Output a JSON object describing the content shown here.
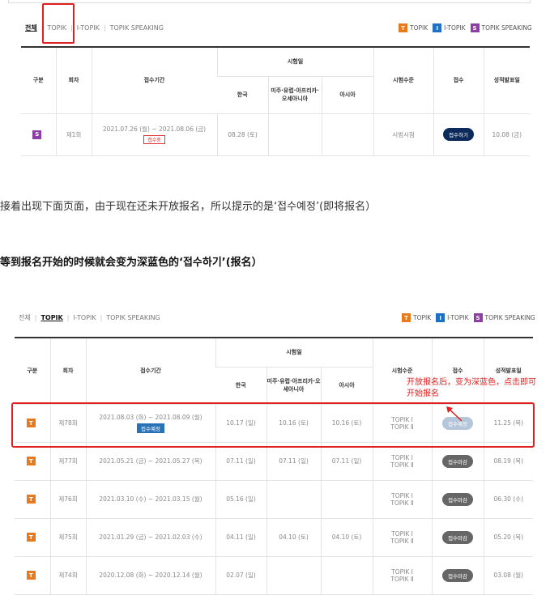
{
  "filters1": {
    "items": [
      "전체",
      "TOPIK",
      "I-TOPIK",
      "TOPIK SPEAKING"
    ],
    "active": 0
  },
  "filters2": {
    "items": [
      "전체",
      "TOPIK",
      "I-TOPIK",
      "TOPIK SPEAKING"
    ],
    "active": 1
  },
  "legend": [
    {
      "letter": "T",
      "label": "TOPIK",
      "color": "#e57a1e"
    },
    {
      "letter": "I",
      "label": "I-TOPIK",
      "color": "#1f6fc5"
    },
    {
      "letter": "S",
      "label": "TOPIK SPEAKING",
      "color": "#8e3fa6"
    }
  ],
  "headers": {
    "type": "구분",
    "round": "회차",
    "period": "접수기간",
    "exam_date": "시험일",
    "korea": "한국",
    "americas": "미주·유럽·아프리카·오세아니아",
    "asia": "아시아",
    "level": "시험수준",
    "apply": "접수",
    "result": "성적발표일"
  },
  "table1_rows": [
    {
      "type": "S",
      "round": "제1회",
      "period": "2021.07.26 (월) ~ 2021.08.06 (금)",
      "period_tag": "접수중",
      "korea": "08.28 (토)",
      "americas": "",
      "asia": "",
      "level": "시범시험",
      "apply": "접수하기",
      "result": "10.08 (금)"
    }
  ],
  "text1": "接着出现下面页面，由于现在还未开放报名，所以提示的是‘접수예정’(即将报名）",
  "text2": "等到报名开始的时候就会变为深蓝色的‘접수하기’(报名）",
  "annotation": "开放报名后，变为深蓝色，点击即可开始报名",
  "table2_rows": [
    {
      "type": "T",
      "round": "제78회",
      "period": "2021.08.03 (화) ~ 2021.08.09 (월)",
      "period_tag": "접수예정",
      "korea": "10.17 (일)",
      "americas": "10.16 (토)",
      "asia": "10.16 (토)",
      "level1": "TOPIK Ⅰ",
      "level2": "TOPIK Ⅱ",
      "apply": "접수예정",
      "result": "11.25 (목)"
    },
    {
      "type": "T",
      "round": "제77회",
      "period": "2021.05.21 (금) ~ 2021.05.27 (목)",
      "period_tag": "",
      "korea": "07.11 (일)",
      "americas": "07.11 (일)",
      "asia": "07.11 (일)",
      "level1": "TOPIK Ⅰ",
      "level2": "TOPIK Ⅱ",
      "apply": "접수마감",
      "result": "08.19 (목)"
    },
    {
      "type": "T",
      "round": "제76회",
      "period": "2021.03.10 (수) ~ 2021.03.15 (월)",
      "period_tag": "",
      "korea": "05.16 (일)",
      "americas": "",
      "asia": "",
      "level1": "TOPIK Ⅰ",
      "level2": "TOPIK Ⅱ",
      "apply": "접수마감",
      "result": "06.30 (수)"
    },
    {
      "type": "T",
      "round": "제75회",
      "period": "2021.01.29 (금) ~ 2021.02.03 (수)",
      "period_tag": "",
      "korea": "04.11 (일)",
      "americas": "04.10 (토)",
      "asia": "04.10 (토)",
      "level1": "TOPIK Ⅰ",
      "level2": "TOPIK Ⅱ",
      "apply": "접수마감",
      "result": "05.20 (목)"
    },
    {
      "type": "T",
      "round": "제74회",
      "period": "2020.12.08 (화) ~ 2020.12.14 (월)",
      "period_tag": "",
      "korea": "02.07 (일)",
      "americas": "",
      "asia": "",
      "level1": "TOPIK Ⅰ",
      "level2": "TOPIK Ⅱ",
      "apply": "접수마감",
      "result": "03.08 (월)"
    }
  ]
}
